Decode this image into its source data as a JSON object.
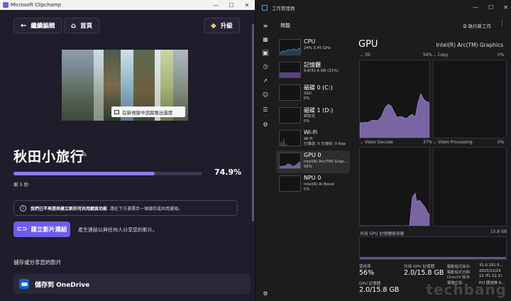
{
  "clipchamp": {
    "window_title": "Microsoft Clipchamp",
    "back_button": "繼續編輯",
    "home_button": "首頁",
    "upgrade_button": "升級",
    "export_tab_text": "在新視窗中追蹤匯出進度",
    "project_title": "秋田小旅行",
    "progress_percent_label": "74.9%",
    "progress_value": 0.749,
    "remaining": "剩 5 秒",
    "notice_bold": "我們已不再提供建立新的可共用網頁功能",
    "notice_text": "請在下方選擇另一個儲存或共用選項。",
    "create_link_button": "建立影片連結",
    "link_description": "產生連結以與任何人分享您的影片。",
    "save_heading": "儲存或分享您的影片",
    "onedrive_label": "儲存到 OneDrive",
    "accent_color": "#6c5ce7"
  },
  "taskmanager": {
    "window_title": "工作管理員",
    "section_title": "效能",
    "run_task_label": "執行新工作",
    "rail_icons": [
      "menu-icon",
      "processes-icon",
      "performance-icon",
      "history-icon",
      "startup-icon",
      "users-icon",
      "details-icon",
      "services-icon",
      "settings-icon"
    ],
    "items": [
      {
        "name": "CPU",
        "sub1": "24% 3.45 GHz",
        "sub2": ""
      },
      {
        "name": "記憶體",
        "sub1": "9.8/31.6 GB (31%)",
        "sub2": ""
      },
      {
        "name": "磁碟 0 (C:)",
        "sub1": "SSD",
        "sub2": "0%"
      },
      {
        "name": "磁碟 1 (D:)",
        "sub1": "卸除式",
        "sub2": "0%"
      },
      {
        "name": "Wi-Fi",
        "sub1": "Wi-Fi",
        "sub2": "已傳送: 0 已接收: 0 Kbp"
      },
      {
        "name": "GPU 0",
        "sub1": "Intel(R) Arc(TM) Grap...",
        "sub2": "56%"
      },
      {
        "name": "NPU 0",
        "sub1": "Intel(R) AI Boost",
        "sub2": "0%"
      }
    ],
    "gpu_title": "GPU",
    "gpu_model": "Intel(R) Arc(TM) Graphics",
    "graph_labels": {
      "g3d": "3D",
      "g3d_pct": "56%",
      "copy": "Copy",
      "copy_pct": "0%",
      "vdec": "Video Decode",
      "vdec_pct": "37%",
      "vproc": "Video Processing",
      "vproc_pct": "0%",
      "shared": "共用 GPU 記憶體使用量",
      "shared_max": "15.8 GB"
    },
    "stats": {
      "util_label": "使用率",
      "util_value": "56%",
      "shared_label": "共用 GPU 記憶體",
      "shared_value": "2.0/15.8 GB",
      "gpu_mem_label": "GPU 記憶體",
      "gpu_mem_value": "2.0/15.8 GB"
    },
    "details": [
      {
        "k": "驅動程式版本:",
        "v": "31.0.101.5..."
      },
      {
        "k": "驅動程式日期:",
        "v": "2023/11/23"
      },
      {
        "k": "DirectX 版本:",
        "v": "12 (FL 12.1)"
      },
      {
        "k": "實體位置:",
        "v": "PCI 匯流排 0..."
      }
    ],
    "purple": "#9b7fd4"
  },
  "watermark": "techbang"
}
